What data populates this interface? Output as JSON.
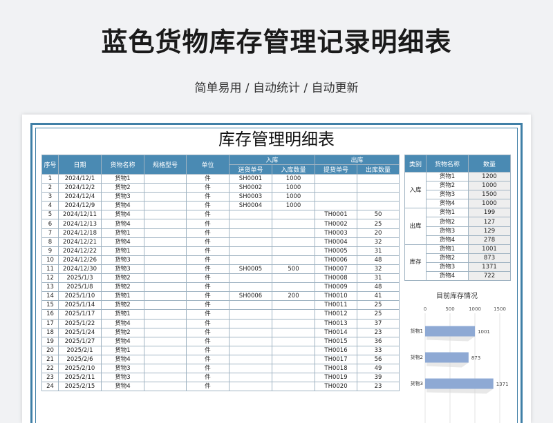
{
  "page": {
    "title": "蓝色货物库存管理记录明细表",
    "subtitle": "简单易用 / 自动统计 / 自动更新"
  },
  "sheet": {
    "title": "库存管理明细表",
    "headers": {
      "seq": "序号",
      "date": "日期",
      "name": "货物名称",
      "spec": "规格型号",
      "unit": "单位",
      "in_group": "入库",
      "out_group": "出库",
      "in_no": "送货单号",
      "in_qty": "入库数量",
      "out_no": "提货单号",
      "out_qty": "出库数量"
    },
    "rows": [
      [
        "1",
        "2024/12/1",
        "货物1",
        "",
        "件",
        "SH0001",
        "1000",
        "",
        ""
      ],
      [
        "2",
        "2024/12/2",
        "货物2",
        "",
        "件",
        "SH0002",
        "1000",
        "",
        ""
      ],
      [
        "3",
        "2024/12/4",
        "货物3",
        "",
        "件",
        "SH0003",
        "1000",
        "",
        ""
      ],
      [
        "4",
        "2024/12/9",
        "货物4",
        "",
        "件",
        "SH0004",
        "1000",
        "",
        ""
      ],
      [
        "5",
        "2024/12/11",
        "货物4",
        "",
        "件",
        "",
        "",
        "TH0001",
        "50"
      ],
      [
        "6",
        "2024/12/13",
        "货物4",
        "",
        "件",
        "",
        "",
        "TH0002",
        "25"
      ],
      [
        "7",
        "2024/12/18",
        "货物1",
        "",
        "件",
        "",
        "",
        "TH0003",
        "20"
      ],
      [
        "8",
        "2024/12/21",
        "货物4",
        "",
        "件",
        "",
        "",
        "TH0004",
        "32"
      ],
      [
        "9",
        "2024/12/22",
        "货物1",
        "",
        "件",
        "",
        "",
        "TH0005",
        "31"
      ],
      [
        "10",
        "2024/12/26",
        "货物3",
        "",
        "件",
        "",
        "",
        "TH0006",
        "48"
      ],
      [
        "11",
        "2024/12/30",
        "货物3",
        "",
        "件",
        "SH0005",
        "500",
        "TH0007",
        "32"
      ],
      [
        "12",
        "2025/1/3",
        "货物2",
        "",
        "件",
        "",
        "",
        "TH0008",
        "31"
      ],
      [
        "13",
        "2025/1/8",
        "货物2",
        "",
        "件",
        "",
        "",
        "TH0009",
        "48"
      ],
      [
        "14",
        "2025/1/10",
        "货物1",
        "",
        "件",
        "SH0006",
        "200",
        "TH0010",
        "41"
      ],
      [
        "15",
        "2025/1/14",
        "货物2",
        "",
        "件",
        "",
        "",
        "TH0011",
        "25"
      ],
      [
        "16",
        "2025/1/17",
        "货物1",
        "",
        "件",
        "",
        "",
        "TH0012",
        "25"
      ],
      [
        "17",
        "2025/1/22",
        "货物4",
        "",
        "件",
        "",
        "",
        "TH0013",
        "37"
      ],
      [
        "18",
        "2025/1/24",
        "货物2",
        "",
        "件",
        "",
        "",
        "TH0014",
        "23"
      ],
      [
        "19",
        "2025/1/27",
        "货物4",
        "",
        "件",
        "",
        "",
        "TH0015",
        "36"
      ],
      [
        "20",
        "2025/2/1",
        "货物1",
        "",
        "件",
        "",
        "",
        "TH0016",
        "33"
      ],
      [
        "21",
        "2025/2/6",
        "货物4",
        "",
        "件",
        "",
        "",
        "TH0017",
        "56"
      ],
      [
        "22",
        "2025/2/10",
        "货物3",
        "",
        "件",
        "",
        "",
        "TH0018",
        "49"
      ],
      [
        "23",
        "2025/2/11",
        "货物3",
        "",
        "件",
        "",
        "",
        "TH0019",
        "39"
      ],
      [
        "24",
        "2025/2/15",
        "货物4",
        "",
        "件",
        "",
        "",
        "TH0020",
        "23"
      ]
    ]
  },
  "summary": {
    "headers": {
      "category": "类别",
      "name": "货物名称",
      "qty": "数量"
    },
    "groups": [
      {
        "category": "入库",
        "items": [
          [
            "货物1",
            "1200"
          ],
          [
            "货物2",
            "1000"
          ],
          [
            "货物3",
            "1500"
          ],
          [
            "货物4",
            "1000"
          ]
        ]
      },
      {
        "category": "出库",
        "items": [
          [
            "货物1",
            "199"
          ],
          [
            "货物2",
            "127"
          ],
          [
            "货物3",
            "129"
          ],
          [
            "货物4",
            "278"
          ]
        ]
      },
      {
        "category": "库存",
        "items": [
          [
            "货物1",
            "1001"
          ],
          [
            "货物2",
            "873"
          ],
          [
            "货物3",
            "1371"
          ],
          [
            "货物4",
            "722"
          ]
        ]
      }
    ]
  },
  "chart_data": {
    "type": "bar",
    "orientation": "horizontal",
    "title": "目前库存情况",
    "categories": [
      "货物1",
      "货物2",
      "货物3"
    ],
    "values": [
      1001,
      873,
      1371
    ],
    "xlim": [
      0,
      1500
    ],
    "xticks": [
      "0",
      "500",
      "1000",
      "1500"
    ],
    "bar_color": "#8ea9d4",
    "grid": true
  },
  "colors": {
    "header": "#4a8ab3",
    "frame": "#3f7fa6"
  }
}
